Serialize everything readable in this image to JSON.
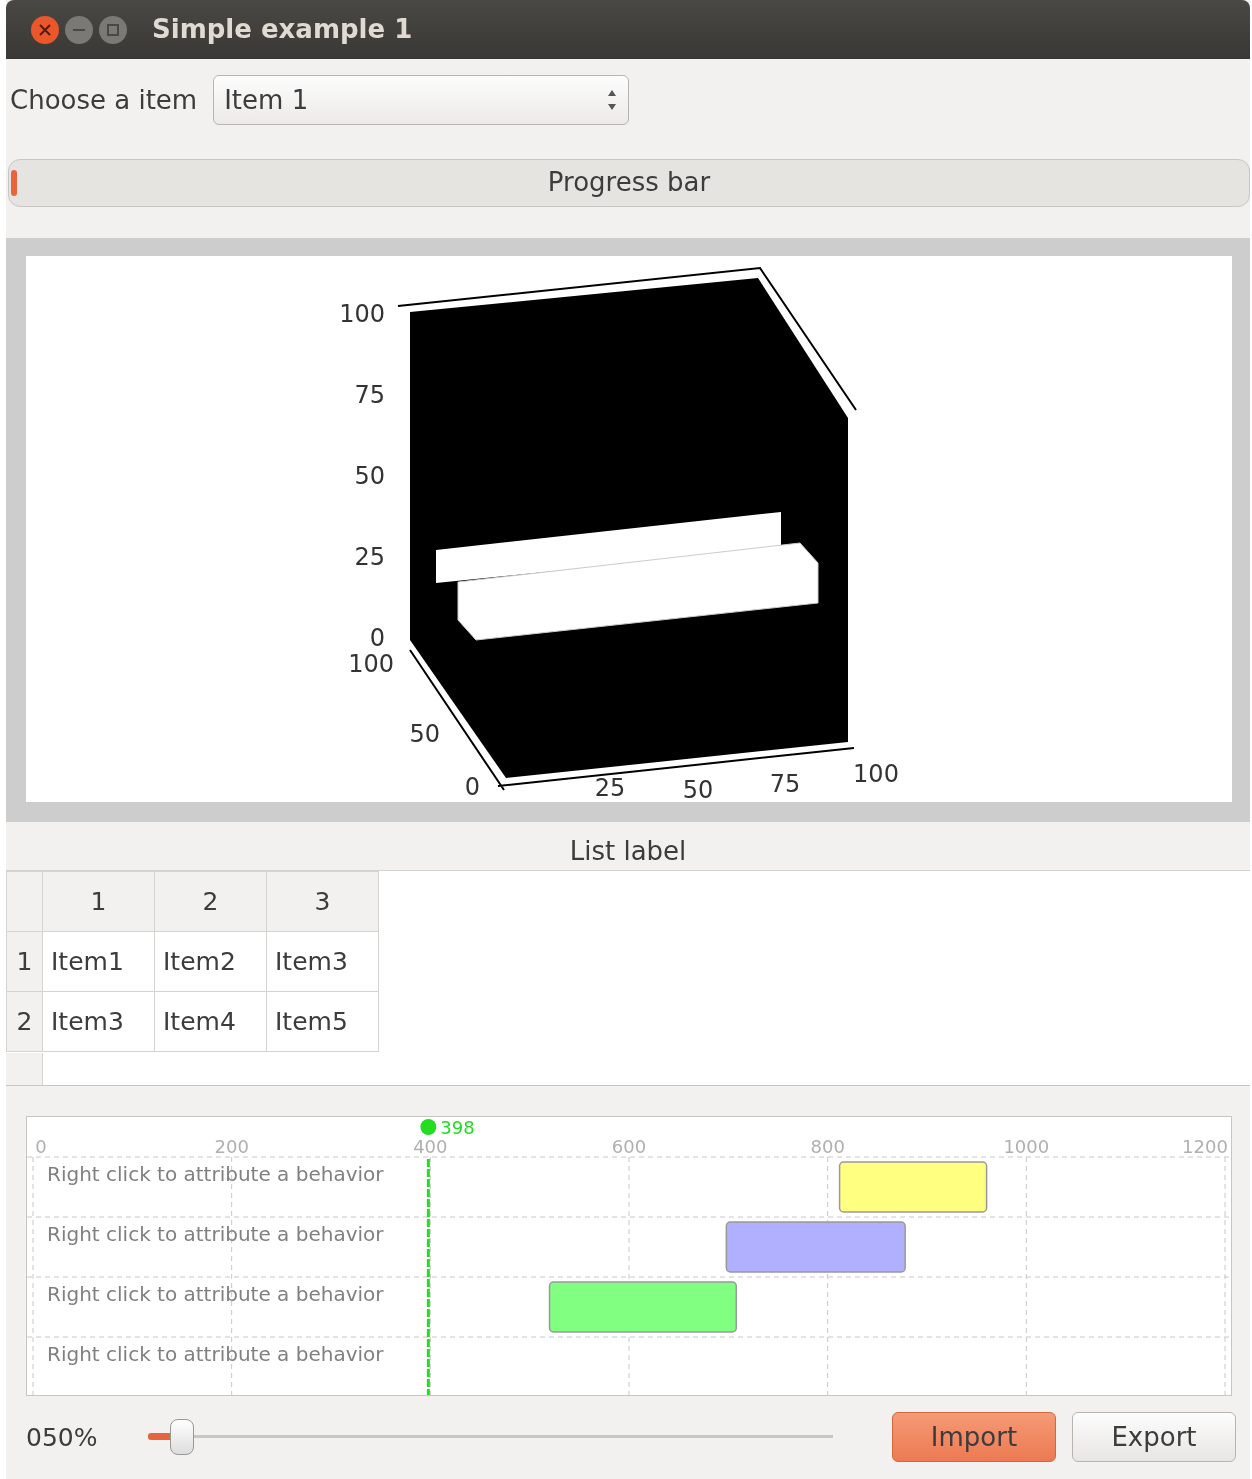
{
  "window": {
    "title": "Simple example 1"
  },
  "chooser": {
    "label": "Choose a item",
    "value": "Item 1"
  },
  "progress": {
    "label": "Progress bar",
    "level": 0.005
  },
  "plot3d": {
    "z_ticks": [
      "100",
      "75",
      "50",
      "25",
      "0"
    ],
    "y_ticks": [
      "100",
      "50",
      "0"
    ],
    "x_ticks": [
      "25",
      "50",
      "75",
      "100"
    ]
  },
  "list": {
    "label": "List label",
    "columns": [
      "1",
      "2",
      "3"
    ],
    "rows": [
      {
        "header": "1",
        "cells": [
          "Item1",
          "Item2",
          "Item3"
        ]
      },
      {
        "header": "2",
        "cells": [
          "Item3",
          "Item4",
          "Item5"
        ]
      }
    ]
  },
  "timeline": {
    "ticks": [
      "0",
      "200",
      "400",
      "600",
      "800",
      "1000",
      "1200"
    ],
    "cursor": "398",
    "tracks": [
      {
        "label": "Right click to attribute a behavior",
        "color": "#ffff80"
      },
      {
        "label": "Right click to attribute a behavior",
        "color": "#b0b0ff"
      },
      {
        "label": "Right click to attribute a behavior",
        "color": "#80ff80"
      },
      {
        "label": "Right click to attribute a behavior"
      }
    ]
  },
  "zoom": {
    "reading": "050%",
    "level": 0.05
  },
  "buttons": [
    {
      "label": "Import",
      "highlighted": true
    },
    {
      "label": "Export",
      "highlighted": false
    }
  ]
}
